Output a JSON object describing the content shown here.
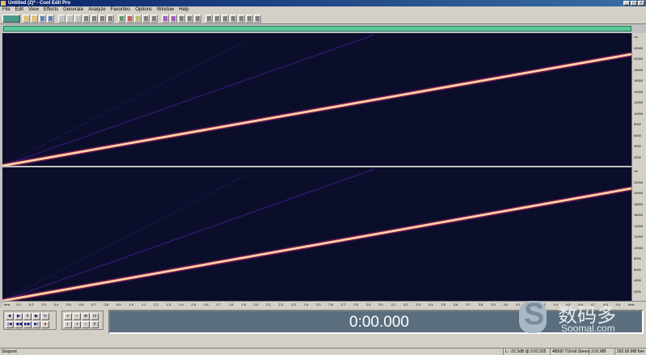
{
  "window": {
    "title": "Untitled (2)* - Cool Edit Pro"
  },
  "menu": [
    "File",
    "Edit",
    "View",
    "Effects",
    "Generate",
    "Analyze",
    "Favorites",
    "Options",
    "Window",
    "Help"
  ],
  "time_display": "0:00.000",
  "watermark": {
    "cn": "数码多",
    "url": "Soomal.com"
  },
  "status": {
    "state": "Stopped",
    "level": "L: -22.3dB @ 0:02.935",
    "format": "48000 ?16-bit Stereo",
    "size": "3.01 MB",
    "free": "262.00 MB free"
  },
  "vruler_labels": [
    "Hz",
    "22000",
    "20000",
    "18000",
    "16000",
    "14000",
    "12000",
    "10000",
    "8000",
    "6000",
    "4000",
    "2000",
    "Hz",
    "22000",
    "20000",
    "18000",
    "16000",
    "14000",
    "12000",
    "10000",
    "8000",
    "6000",
    "4000",
    "2000"
  ],
  "hruler_labels": [
    "hms",
    "0.1",
    "0.2",
    "0.3",
    "0.4",
    "0.5",
    "0.6",
    "0.7",
    "0.8",
    "0.9",
    "1.0",
    "1.1",
    "1.2",
    "1.3",
    "1.4",
    "1.5",
    "1.6",
    "1.7",
    "1.8",
    "1.9",
    "2.0",
    "2.1",
    "2.2",
    "2.3",
    "2.4",
    "2.5",
    "2.6",
    "2.7",
    "2.8",
    "2.9",
    "3.0",
    "3.1",
    "3.2",
    "3.3",
    "3.4",
    "3.5",
    "3.6",
    "3.7",
    "3.8",
    "3.9",
    "4.0",
    "4.1",
    "4.2",
    "4.3",
    "4.4",
    "4.5",
    "4.6",
    "4.7",
    "4.8",
    "4.9",
    "hms"
  ]
}
